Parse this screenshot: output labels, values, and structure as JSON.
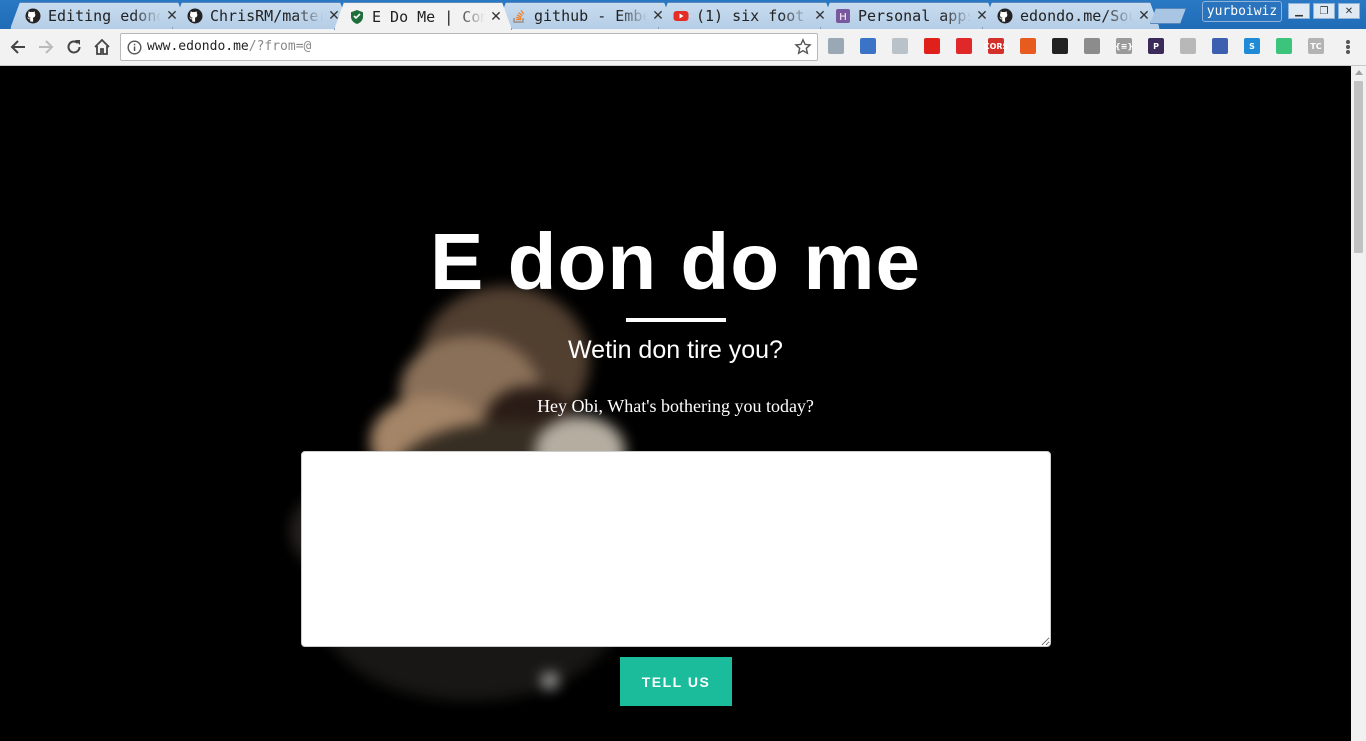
{
  "browser": {
    "tabs": [
      {
        "title": "Editing edondo.me",
        "icon": "github-icon",
        "active": false
      },
      {
        "title": "ChrisRM/material",
        "icon": "github-icon",
        "active": false
      },
      {
        "title": "E Do Me | Complain",
        "icon": "shield-icon",
        "active": true
      },
      {
        "title": "github - Embed",
        "icon": "stackoverflow-icon",
        "active": false
      },
      {
        "title": "(1) six foot",
        "icon": "youtube-icon",
        "active": false
      },
      {
        "title": "Personal apps",
        "icon": "heroku-icon",
        "active": false
      },
      {
        "title": "edondo.me/Source",
        "icon": "github-icon",
        "active": false
      }
    ],
    "tab_close_glyph": "✕",
    "profile_name": "yurboiwiz",
    "url_host": "www.edondo.me",
    "url_rest": "/?from=@",
    "extensions": [
      {
        "name": "ext-shield-icon",
        "label": "",
        "color": "#9aa7b4"
      },
      {
        "name": "ext-globe-icon",
        "label": "",
        "color": "#3b74c6"
      },
      {
        "name": "ext-cube-icon",
        "label": "",
        "color": "#b9c1c9"
      },
      {
        "name": "ext-opera-icon",
        "label": "",
        "color": "#e0201b"
      },
      {
        "name": "ext-flipboard-icon",
        "label": "",
        "color": "#e12828"
      },
      {
        "name": "ext-cors-icon",
        "label": "CORS",
        "color": "#d3302b"
      },
      {
        "name": "ext-office-icon",
        "label": "",
        "color": "#e85b1e"
      },
      {
        "name": "ext-gnome-icon",
        "label": "",
        "color": "#222222"
      },
      {
        "name": "ext-hexagon-icon",
        "label": "",
        "color": "#8c8c8c"
      },
      {
        "name": "ext-json-icon",
        "label": "{≡}",
        "color": "#9a9a9a"
      },
      {
        "name": "ext-p-icon",
        "label": "P",
        "color": "#3b2a5a"
      },
      {
        "name": "ext-search-icon",
        "label": "",
        "color": "#b8b8b8"
      },
      {
        "name": "ext-block-icon",
        "label": "",
        "color": "#3d5fb0"
      },
      {
        "name": "ext-s-icon",
        "label": "S",
        "color": "#1f8ad6"
      },
      {
        "name": "ext-chat-icon",
        "label": "",
        "color": "#3cc47c"
      },
      {
        "name": "ext-tc-icon",
        "label": "TC",
        "color": "#b3b3b3"
      }
    ]
  },
  "page": {
    "title": "E don do me",
    "subtitle": "Wetin don tire you?",
    "prompt": "Hey Obi, What's bothering you today?",
    "textarea_value": "",
    "submit_label": "Tell us",
    "accent_color": "#1abc9c"
  }
}
